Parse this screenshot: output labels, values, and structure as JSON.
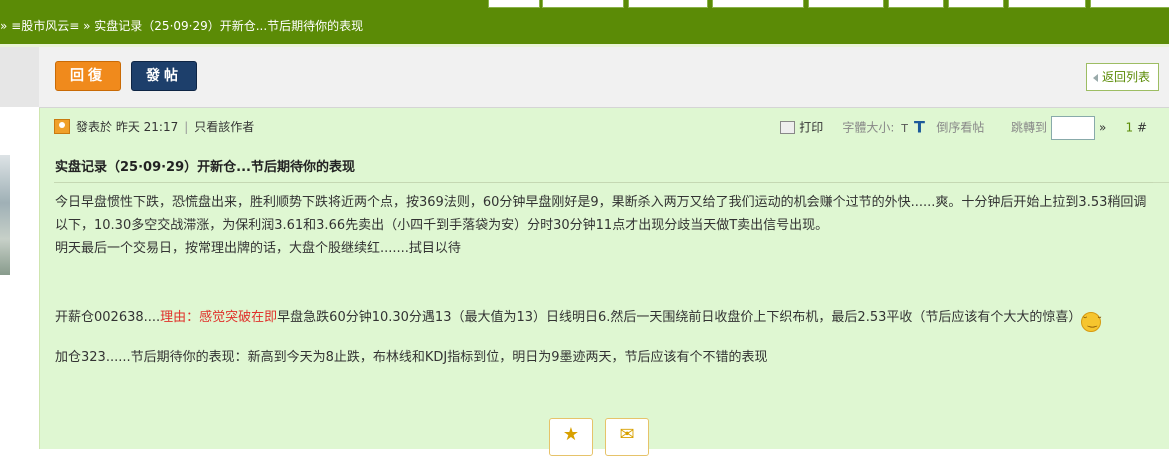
{
  "breadcrumb": {
    "sep1": "»",
    "forum": "≡股市风云≡",
    "sep2": "»",
    "thread": "实盘记录（25·09·29）开新仓...节后期待你的表现"
  },
  "toolbar": {
    "reply_label": "回復",
    "post_label": "發帖",
    "back_label": "返回列表"
  },
  "post_meta": {
    "posted_prefix": "發表於",
    "posted_time": "昨天 21:17",
    "divider": "|",
    "only_author": "只看該作者",
    "print": "打印",
    "font_size_label": "字體大小:",
    "small_t": "T",
    "big_t": "T",
    "reverse_order": "倒序看帖",
    "jump_to": "跳轉到",
    "jump_arrow": "»",
    "floor_number": "1",
    "floor_suffix": "#"
  },
  "post": {
    "title": "实盘记录（25·09·29）开新仓...节后期待你的表现",
    "para1": "今日早盘惯性下跌，恐慌盘出来，胜利顺势下跌将近两个点，按369法则，60分钟早盘刚好是9，果断杀入两万又给了我们运动的机会赚个过节的外快......爽。十分钟后开始上拉到3.53稍回调以下，10.30多空交战滞涨，为保利润3.61和3.66先卖出（小四千到手落袋为安）分时30分钟11点才出现分歧当天做T卖出信号出现。",
    "para2": "明天最后一个交易日，按常理出牌的话，大盘个股继续红.......拭目以待",
    "para3_before": "开薪仓002638....",
    "para3_red": "理由：感觉突破在即",
    "para3_after": "早盘急跌60分钟10.30分遇13（最大值为13）日线明日6.然后一天围绕前日收盘价上下织布机，最后2.53平收（节后应该有个大大的惊喜）",
    "para4": "加仓323......节后期待你的表现：新高到今天为8止跌，布林线和KDJ指标到位，明日为9墨迹两天，节后应该有个不错的表现"
  },
  "icons": {
    "favorite": "star-icon",
    "share": "envelope-icon",
    "emoji": "shy-face-icon"
  },
  "colors": {
    "topbar": "#5b8b06",
    "post_bg": "#dff7d2",
    "reply_button": "#f08a1c",
    "post_button": "#1d3f6b",
    "highlight_text": "#e0302a"
  }
}
